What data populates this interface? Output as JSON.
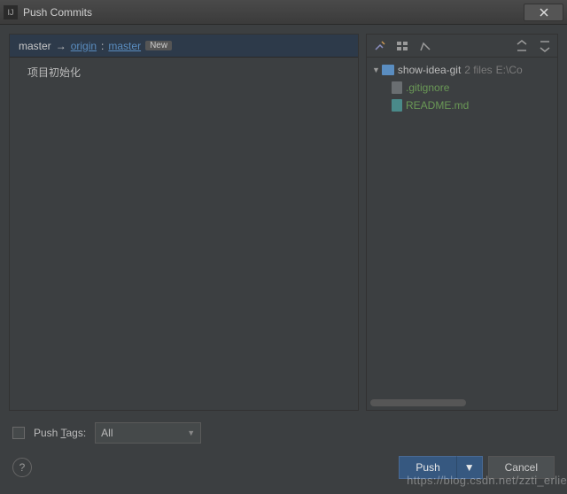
{
  "window": {
    "title": "Push Commits"
  },
  "branch": {
    "local": "master",
    "arrow": "→",
    "remote": "origin",
    "sep": ":",
    "tracking": "master",
    "badge": "New"
  },
  "commits": [
    {
      "message": "项目初始化"
    }
  ],
  "filetree": {
    "root": {
      "name": "show-idea-git",
      "files_count": "2 files",
      "path": "E:\\Co"
    },
    "files": [
      {
        "name": ".gitignore",
        "type": "text"
      },
      {
        "name": "README.md",
        "type": "md"
      }
    ]
  },
  "options": {
    "push_tags_label_pre": "Push ",
    "push_tags_label_u": "T",
    "push_tags_label_post": "ags:",
    "tags_mode": "All"
  },
  "buttons": {
    "push": "Push",
    "cancel": "Cancel"
  },
  "watermark": "https://blog.csdn.net/zzti_erlie"
}
